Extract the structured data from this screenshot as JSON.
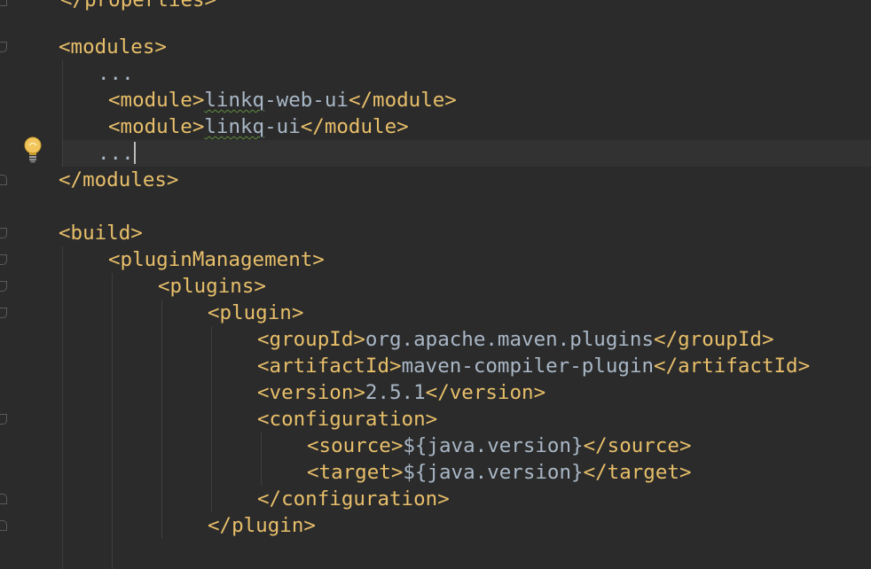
{
  "editor": {
    "language": "xml",
    "lines": [
      {
        "id": "properties-close",
        "segments": [
          {
            "t": "tag",
            "v": "</properties>"
          }
        ]
      },
      {
        "id": "modules-open",
        "segments": [
          {
            "t": "tag",
            "v": "<modules>"
          }
        ]
      },
      {
        "id": "ellipsis-1",
        "segments": [
          {
            "t": "ell",
            "v": "..."
          }
        ]
      },
      {
        "id": "module-web-ui",
        "segments": [
          {
            "t": "tag",
            "v": "<module>"
          },
          {
            "t": "txt-squiggle",
            "v": "linkq"
          },
          {
            "t": "txt",
            "v": "-web-ui"
          },
          {
            "t": "tag",
            "v": "</module>"
          }
        ]
      },
      {
        "id": "module-ui",
        "segments": [
          {
            "t": "tag",
            "v": "<module>"
          },
          {
            "t": "txt-squiggle",
            "v": "linkq"
          },
          {
            "t": "txt",
            "v": "-ui"
          },
          {
            "t": "tag",
            "v": "</module>"
          }
        ]
      },
      {
        "id": "ellipsis-2",
        "segments": [
          {
            "t": "ell",
            "v": "..."
          }
        ]
      },
      {
        "id": "modules-close",
        "segments": [
          {
            "t": "tag",
            "v": "</modules>"
          }
        ]
      },
      {
        "id": "build-open",
        "segments": [
          {
            "t": "tag",
            "v": "<build>"
          }
        ]
      },
      {
        "id": "plugin-management-open",
        "segments": [
          {
            "t": "tag",
            "v": "<pluginManagement>"
          }
        ]
      },
      {
        "id": "plugins-open",
        "segments": [
          {
            "t": "tag",
            "v": "<plugins>"
          }
        ]
      },
      {
        "id": "plugin-open",
        "segments": [
          {
            "t": "tag",
            "v": "<plugin>"
          }
        ]
      },
      {
        "id": "group-id",
        "segments": [
          {
            "t": "tag",
            "v": "<groupId>"
          },
          {
            "t": "txt",
            "v": "org.apache.maven.plugins"
          },
          {
            "t": "tag",
            "v": "</groupId>"
          }
        ]
      },
      {
        "id": "artifact-id",
        "segments": [
          {
            "t": "tag",
            "v": "<artifactId>"
          },
          {
            "t": "txt",
            "v": "maven-compiler-plugin"
          },
          {
            "t": "tag",
            "v": "</artifactId>"
          }
        ]
      },
      {
        "id": "version",
        "segments": [
          {
            "t": "tag",
            "v": "<version>"
          },
          {
            "t": "txt",
            "v": "2.5.1"
          },
          {
            "t": "tag",
            "v": "</version>"
          }
        ]
      },
      {
        "id": "configuration-open",
        "segments": [
          {
            "t": "tag",
            "v": "<configuration>"
          }
        ]
      },
      {
        "id": "source",
        "segments": [
          {
            "t": "tag",
            "v": "<source>"
          },
          {
            "t": "txt",
            "v": "${java.version}"
          },
          {
            "t": "tag",
            "v": "</source>"
          }
        ]
      },
      {
        "id": "target",
        "segments": [
          {
            "t": "tag",
            "v": "<target>"
          },
          {
            "t": "txt",
            "v": "${java.version}"
          },
          {
            "t": "tag",
            "v": "</target>"
          }
        ]
      },
      {
        "id": "configuration-close",
        "segments": [
          {
            "t": "tag",
            "v": "</configuration>"
          }
        ]
      },
      {
        "id": "plugin-close",
        "segments": [
          {
            "t": "tag",
            "v": "</plugin>"
          }
        ]
      }
    ]
  },
  "icons": {
    "intention": "lightbulb-icon",
    "fold": "fold-marker-icon"
  },
  "colors": {
    "background": "#2b2b2b",
    "caret_row": "#323232",
    "tag": "#e8bf6a",
    "text": "#a9b7c6",
    "typo_underline": "#5f8d3c",
    "bulb": "#f2c55c"
  }
}
